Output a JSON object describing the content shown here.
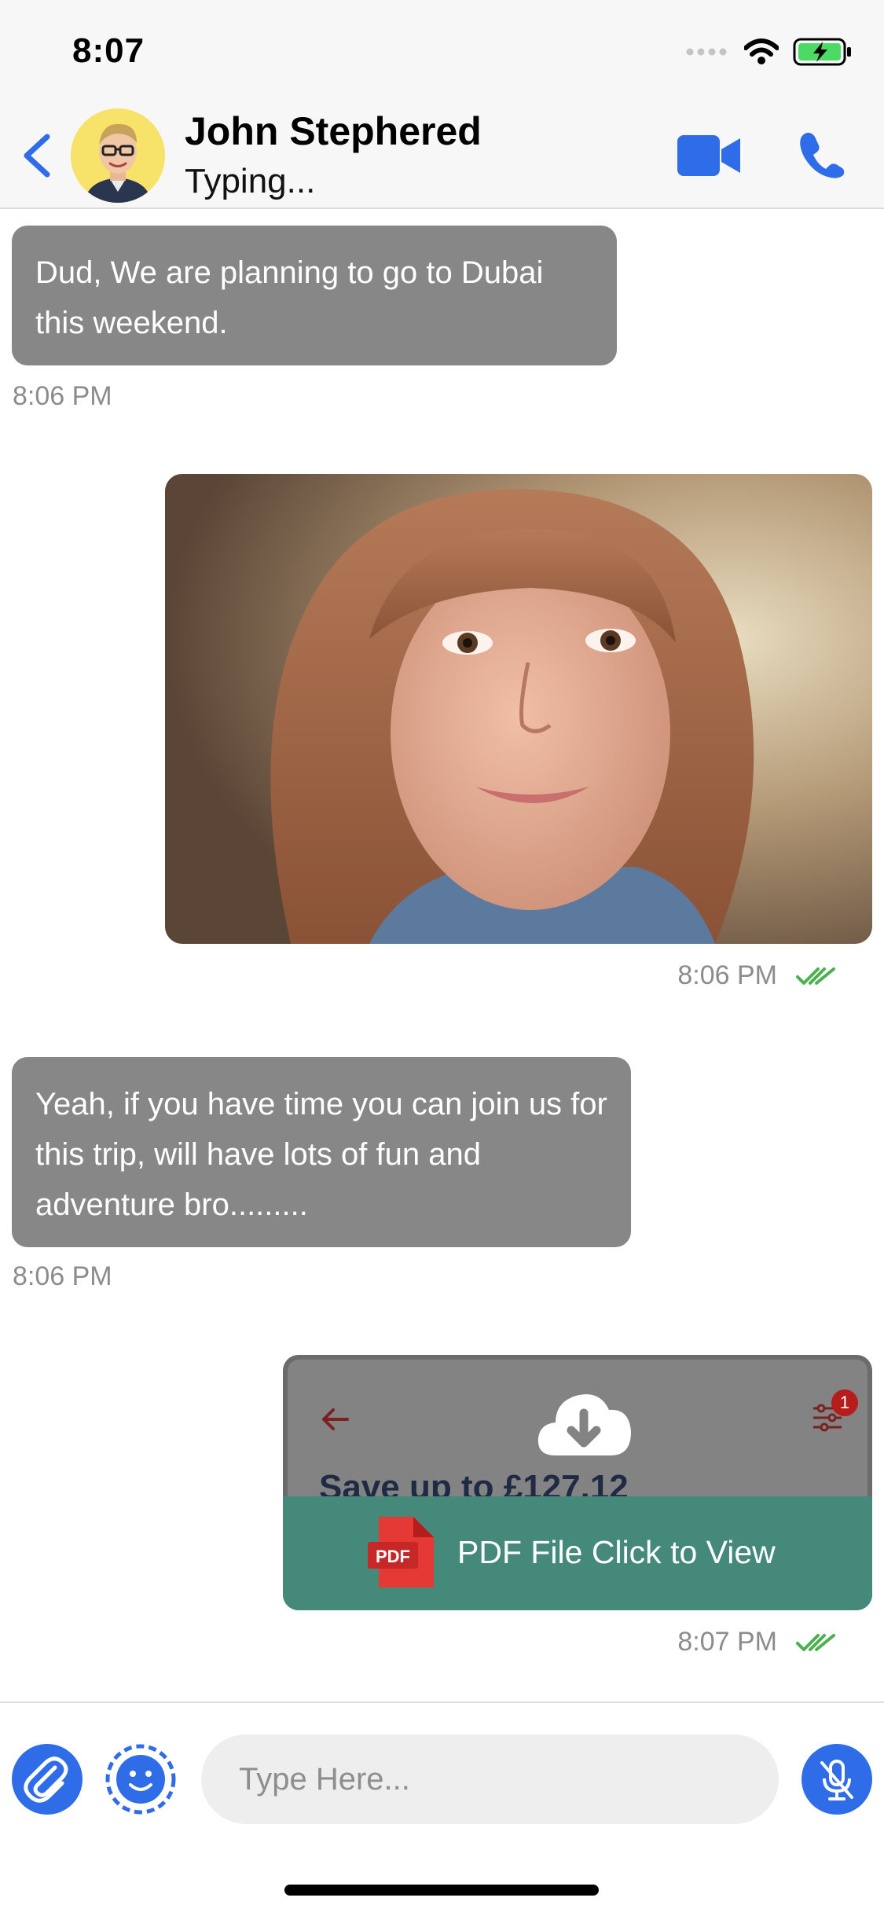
{
  "status_bar": {
    "time": "8:07"
  },
  "header": {
    "contact_name": "John Stephered",
    "contact_status": "Typing..."
  },
  "messages": [
    {
      "direction": "incoming",
      "text": "Dud, We are planning to go to Dubai this weekend.",
      "time": "8:06 PM"
    },
    {
      "direction": "outgoing",
      "type": "image",
      "time": "8:06 PM",
      "read": true
    },
    {
      "direction": "incoming",
      "text": "Yeah, if you have time you can join us for this trip, will have lots of fun and adventure bro.........",
      "time": "8:06 PM"
    },
    {
      "direction": "outgoing",
      "type": "pdf",
      "preview_text": "Save up to £127.12",
      "preview_badge": "1",
      "pdf_icon_text": "PDF",
      "label": "PDF File Click to View",
      "time": "8:07 PM",
      "read": true
    }
  ],
  "composer": {
    "placeholder": "Type Here..."
  },
  "colors": {
    "accent": "#2f6de8",
    "incoming_bubble": "#878787",
    "pdf_footer": "#45897b",
    "read_check": "#4cb04f"
  }
}
